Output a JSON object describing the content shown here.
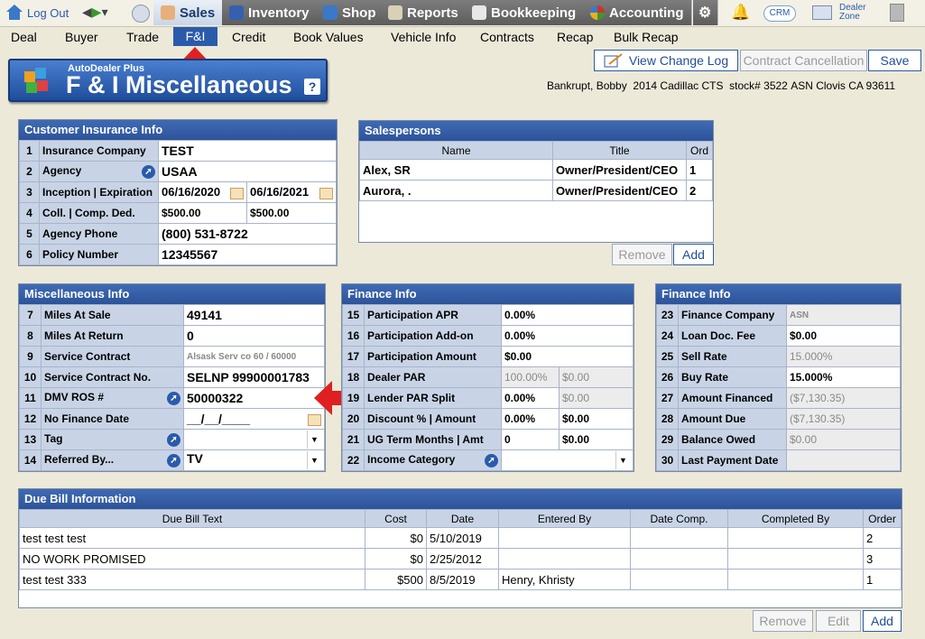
{
  "topnav": {
    "logout": "Log Out",
    "tabs": [
      "Sales",
      "Inventory",
      "Shop",
      "Reports",
      "Bookkeeping",
      "Accounting"
    ],
    "crm": "CRM",
    "dealer_zone": "Dealer\nZone"
  },
  "menu": [
    "Deal",
    "Buyer",
    "Trade",
    "F&I",
    "Credit",
    "Book Values",
    "Vehicle Info",
    "Contracts",
    "Recap",
    "Bulk Recap"
  ],
  "header": {
    "brand": "AutoDealer Plus",
    "title": "F & I Miscellaneous",
    "help": "?",
    "view_change_log": "View Change Log",
    "contract_cancellation": "Contract Cancellation",
    "save": "Save",
    "customer": "Bankrupt,  Bobby",
    "vehicle": "2014 Cadillac CTS",
    "stock": "stock# 3522",
    "location": "ASN Clovis CA 93611"
  },
  "customer_insurance": {
    "title": "Customer Insurance Info",
    "rows": [
      {
        "n": "1",
        "label": "Insurance Company",
        "value": "TEST"
      },
      {
        "n": "2",
        "label": "Agency",
        "value": "USAA"
      },
      {
        "n": "3",
        "label": "Inception | Expiration",
        "value": "06/16/2020",
        "value2": "06/16/2021"
      },
      {
        "n": "4",
        "label": "Coll. | Comp. Ded.",
        "value": "$500.00",
        "value2": "$500.00"
      },
      {
        "n": "5",
        "label": "Agency Phone",
        "value": "(800) 531-8722"
      },
      {
        "n": "6",
        "label": "Policy Number",
        "value": "12345567"
      }
    ]
  },
  "salespersons": {
    "title": "Salespersons",
    "headers": [
      "Name",
      "Title",
      "Ord"
    ],
    "rows": [
      [
        "Alex, SR",
        "Owner/President/CEO",
        "1"
      ],
      [
        "Aurora, .",
        "Owner/President/CEO",
        "2"
      ]
    ],
    "remove": "Remove",
    "add": "Add"
  },
  "misc_info": {
    "title": "Miscellaneous Info",
    "rows": [
      {
        "n": "7",
        "label": "Miles At Sale",
        "value": "49141"
      },
      {
        "n": "8",
        "label": "Miles At Return",
        "value": "0"
      },
      {
        "n": "9",
        "label": "Service Contract",
        "value": "Alsask Serv co 60 / 60000"
      },
      {
        "n": "10",
        "label": "Service Contract No.",
        "value": "SELNP 99900001783"
      },
      {
        "n": "11",
        "label": "DMV ROS #",
        "value": "50000322"
      },
      {
        "n": "12",
        "label": "No Finance Date",
        "value": "__/__/____"
      },
      {
        "n": "13",
        "label": "Tag",
        "value": ""
      },
      {
        "n": "14",
        "label": "Referred By...",
        "value": "TV"
      }
    ]
  },
  "finance_mid": {
    "title": "Finance Info",
    "rows": [
      {
        "n": "15",
        "label": "Participation APR",
        "value": "0.00%"
      },
      {
        "n": "16",
        "label": "Participation Add-on",
        "value": "0.00%"
      },
      {
        "n": "17",
        "label": "Participation Amount",
        "value": "$0.00"
      },
      {
        "n": "18",
        "label": "Dealer PAR",
        "value": "100.00%",
        "value2": "$0.00"
      },
      {
        "n": "19",
        "label": "Lender PAR Split",
        "value": "0.00%",
        "value2": "$0.00"
      },
      {
        "n": "20",
        "label": "Discount % | Amount",
        "value": "0.00%",
        "value2": "$0.00"
      },
      {
        "n": "21",
        "label": "UG Term Months | Amt",
        "value": "0",
        "value2": "$0.00"
      },
      {
        "n": "22",
        "label": "Income Category",
        "value": ""
      }
    ]
  },
  "finance_right": {
    "title": "Finance Info",
    "rows": [
      {
        "n": "23",
        "label": "Finance Company",
        "value": "ASN"
      },
      {
        "n": "24",
        "label": "Loan Doc. Fee",
        "value": "$0.00"
      },
      {
        "n": "25",
        "label": "Sell Rate",
        "value": "15.000%"
      },
      {
        "n": "26",
        "label": "Buy Rate",
        "value": "15.000%"
      },
      {
        "n": "27",
        "label": "Amount Financed",
        "value": "($7,130.35)"
      },
      {
        "n": "28",
        "label": "Amount Due",
        "value": "($7,130.35)"
      },
      {
        "n": "29",
        "label": "Balance Owed",
        "value": "$0.00"
      },
      {
        "n": "30",
        "label": "Last Payment Date",
        "value": ""
      }
    ]
  },
  "due_bill": {
    "title": "Due Bill Information",
    "headers": [
      "Due Bill Text",
      "Cost",
      "Date",
      "Entered By",
      "Date Comp.",
      "Completed By",
      "Order"
    ],
    "rows": [
      [
        "test test test",
        "$0",
        "5/10/2019",
        "",
        "",
        "",
        "2"
      ],
      [
        "NO WORK PROMISED",
        "$0",
        "2/25/2012",
        "",
        "",
        "",
        "3"
      ],
      [
        "test test 333",
        "$500",
        "8/5/2019",
        "Henry, Khristy",
        "",
        "",
        "1"
      ]
    ],
    "remove": "Remove",
    "edit": "Edit",
    "add": "Add"
  }
}
